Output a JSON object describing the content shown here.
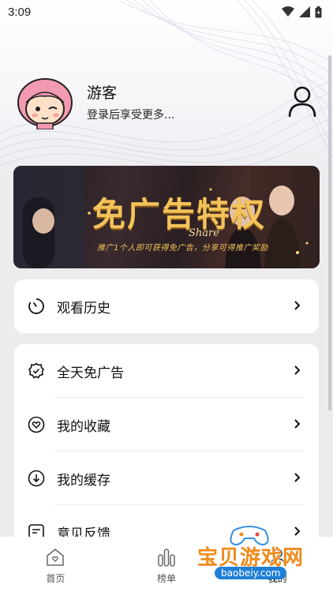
{
  "status_bar": {
    "time": "3:09"
  },
  "profile": {
    "name": "游客",
    "subtitle": "登录后享受更多..."
  },
  "banner": {
    "title": "免广告特权",
    "share": "Share",
    "subtitle": "推广1个人即可获得免广告，分享可得推广奖励"
  },
  "history": {
    "label": "观看历史"
  },
  "menu": {
    "items": [
      {
        "label": "全天免广告",
        "icon": "shield-check-icon"
      },
      {
        "label": "我的收藏",
        "icon": "heart-icon"
      },
      {
        "label": "我的缓存",
        "icon": "download-icon"
      },
      {
        "label": "意见反馈",
        "icon": "feedback-icon"
      }
    ]
  },
  "tabbar": {
    "tabs": [
      {
        "label": "首页",
        "icon": "home-icon"
      },
      {
        "label": "榜单",
        "icon": "chart-icon"
      },
      {
        "label": "我的",
        "icon": "user-icon"
      }
    ]
  },
  "watermark": {
    "text": "宝贝游戏网",
    "url": "baobeiy.com"
  },
  "colors": {
    "banner_gold": "#f3c35a",
    "watermark_orange": "#f08a1c",
    "watermark_blue": "#1f7fd6"
  }
}
